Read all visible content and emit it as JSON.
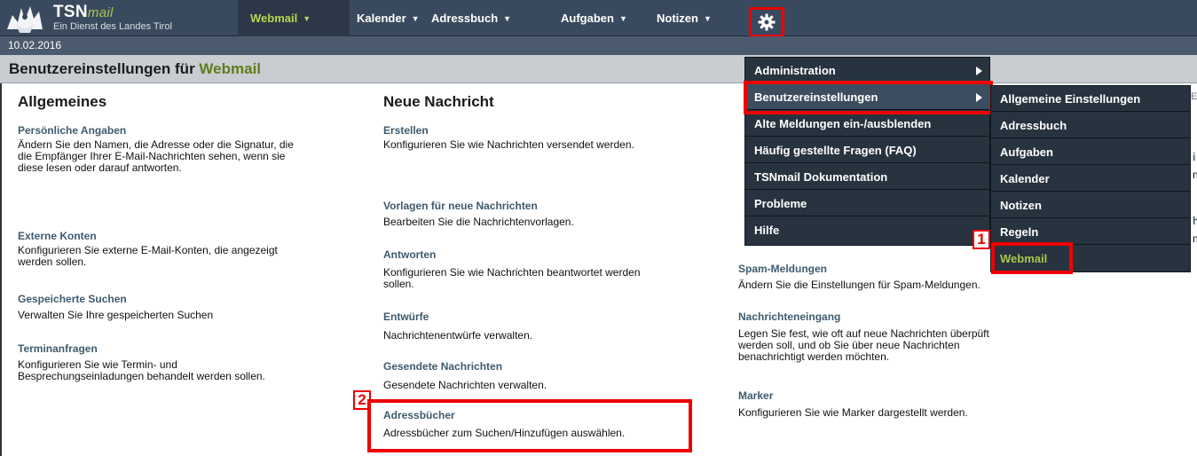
{
  "header": {
    "logo_name": "TSN",
    "logo_name_italic": "mail",
    "logo_sub": "Ein Dienst des Landes Tirol",
    "nav": [
      "Webmail",
      "Kalender",
      "Adressbuch",
      "Aufgaben",
      "Notizen"
    ],
    "accent_color": "#b8d64c"
  },
  "date": "10.02.2016",
  "page": {
    "title_prefix": "Benutzereinstellungen für ",
    "title_app": "Webmail"
  },
  "left_col": {
    "heading": "Allgemeines",
    "items": [
      {
        "title": "Persönliche Angaben",
        "desc": [
          "Ändern Sie den Namen, die Adresse oder die Signatur, die",
          "die Empfänger Ihrer E-Mail-Nachrichten sehen, wenn sie",
          "diese lesen oder darauf antworten."
        ]
      },
      {
        "title": "Externe Konten",
        "desc": [
          "Konfigurieren Sie externe E-Mail-Konten, die angezeigt",
          "werden sollen."
        ]
      },
      {
        "title": "Gespeicherte Suchen",
        "desc": [
          "Verwalten Sie Ihre gespeicherten Suchen"
        ]
      },
      {
        "title": "Terminanfragen",
        "desc": [
          "Konfigurieren Sie wie Termin- und",
          "Besprechungseinladungen behandelt werden sollen."
        ]
      }
    ]
  },
  "mid_col": {
    "heading": "Neue Nachricht",
    "items": [
      {
        "title": "Erstellen",
        "desc": [
          "Konfigurieren Sie wie Nachrichten versendet werden."
        ]
      },
      {
        "title": "Vorlagen für neue Nachrichten",
        "desc": [
          "Bearbeiten Sie die Nachrichtenvorlagen."
        ]
      },
      {
        "title": "Antworten",
        "desc": [
          "Konfigurieren Sie wie Nachrichten beantwortet werden",
          "sollen."
        ]
      },
      {
        "title": "Entwürfe",
        "desc": [
          "Nachrichtenentwürfe verwalten."
        ]
      },
      {
        "title": "Gesendete Nachrichten",
        "desc": [
          "Gesendete Nachrichten verwalten."
        ]
      },
      {
        "title": "Adressbücher",
        "desc": [
          "Adressbücher zum Suchen/Hinzufügen auswählen."
        ]
      }
    ]
  },
  "right_col": {
    "items": [
      {
        "title": "Spam-Meldungen",
        "desc": [
          "Ändern Sie die Einstellungen für Spam-Meldungen."
        ]
      },
      {
        "title": "Nachrichteneingang",
        "desc": [
          "Legen Sie fest, wie oft auf neue Nachrichten überpüft",
          "werden soll, und ob Sie über neue Nachrichten",
          "benachrichtigt werden möchten."
        ]
      },
      {
        "title": "Marker",
        "desc": [
          "Konfigurieren Sie wie Marker dargestellt werden."
        ]
      }
    ]
  },
  "gear_menu": [
    "Administration",
    "Benutzereinstellungen",
    "Alte Meldungen ein-/ausblenden",
    "Häufig gestellte Fragen (FAQ)",
    "TSNmail Dokumentation",
    "Probleme",
    "Hilfe"
  ],
  "submenu": [
    "Allgemeine Einstellungen",
    "Adressbuch",
    "Aufgaben",
    "Kalender",
    "Notizen",
    "Regeln",
    "Webmail"
  ],
  "callouts": [
    "1",
    "2"
  ],
  "edge_fragments": [
    "Ei",
    "i",
    "n",
    "h",
    "n"
  ]
}
